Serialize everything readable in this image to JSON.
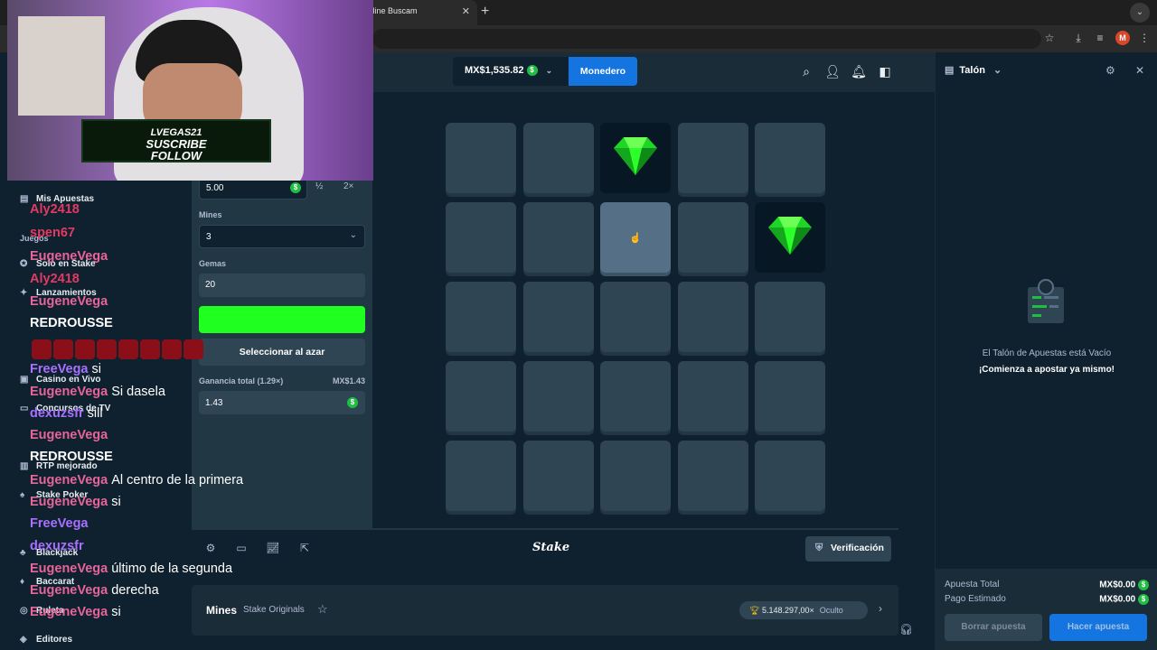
{
  "browser": {
    "tab_title": "- Jugar Online Buscam",
    "tab_close": "✕",
    "new_tab": "+",
    "profile_initial": "M"
  },
  "header": {
    "balance": "MX$1,535.82",
    "wallet_label": "Monedero"
  },
  "sidebar": {
    "items": [
      {
        "label": "Mis Apuestas",
        "icon": "list-icon"
      },
      {
        "label": "Juegos",
        "icon": ""
      },
      {
        "label": "Solo en Stake",
        "icon": "star-icon"
      },
      {
        "label": "Lanzamientos",
        "icon": "rocket-icon"
      },
      {
        "label": "Casino en Vivo",
        "icon": "cards-icon"
      },
      {
        "label": "Concursos de TV",
        "icon": "tv-icon"
      },
      {
        "label": "RTP mejorado",
        "icon": "gift-icon"
      },
      {
        "label": "Stake Poker",
        "icon": "poker-icon"
      },
      {
        "label": "Blackjack",
        "icon": "blackjack-icon"
      },
      {
        "label": "Baccarat",
        "icon": "baccarat-icon"
      },
      {
        "label": "Ruleta",
        "icon": "roulette-icon"
      },
      {
        "label": "Editores",
        "icon": "editor-icon"
      }
    ]
  },
  "controls": {
    "bet_amount": "5.00",
    "half_label": "½",
    "double_label": "2×",
    "mines_label": "Mines",
    "mines_value": "3",
    "gems_label": "Gemas",
    "gems_value": "20",
    "random_label": "Seleccionar al azar",
    "profit_label": "Ganancia total (1.29×)",
    "profit_amount": "MX$1.43",
    "profit_value": "1.43"
  },
  "board": {
    "rows": 5,
    "cols": 5,
    "revealed_gems": [
      [
        0,
        2
      ],
      [
        1,
        4
      ]
    ],
    "hovered": [
      1,
      2
    ]
  },
  "footer": {
    "logo": "Stake",
    "verify_label": "Verificación"
  },
  "game_info": {
    "title": "Mines",
    "subtitle": "Stake Originals",
    "max_win": "5.148.297,00×",
    "hidden_label": "Oculto"
  },
  "betslip": {
    "title": "Talón",
    "empty_title": "El Talón de Apuestas está Vacío",
    "empty_subtitle": "¡Comienza a apostar ya mismo!",
    "total_bet_label": "Apuesta Total",
    "total_bet_value": "MX$0.00",
    "est_payout_label": "Pago Estimado",
    "est_payout_value": "MX$0.00",
    "clear_label": "Borrar apuesta",
    "place_label": "Hacer apuesta"
  },
  "overlay": {
    "banner_line1": "LVEGAS21",
    "banner_line2": "SUSCRIBE",
    "banner_line3": "FOLLOW",
    "chat": [
      {
        "user": "Aly2418",
        "msg": "",
        "color": "#e23a62"
      },
      {
        "user": "spen67",
        "msg": "",
        "color": "#e23a62"
      },
      {
        "user": "EugeneVega",
        "msg": "",
        "color": "#e6659a"
      },
      {
        "user": "Aly2418",
        "msg": "",
        "color": "#e23a62"
      },
      {
        "user": "EugeneVega",
        "msg": "",
        "color": "#e6659a"
      },
      {
        "user": "REDROUSSE",
        "msg": "",
        "color": "#ffffff"
      },
      {
        "user": "FreeVega",
        "msg": "si",
        "color": "#a970ff"
      },
      {
        "user": "EugeneVega",
        "msg": "Si dasela",
        "color": "#e6659a"
      },
      {
        "user": "dexuzsfr",
        "msg": "sill",
        "color": "#a970ff"
      },
      {
        "user": "EugeneVega",
        "msg": "",
        "color": "#e6659a"
      },
      {
        "user": "REDROUSSE",
        "msg": "",
        "color": "#ffffff"
      },
      {
        "user": "EugeneVega",
        "msg": "Al centro de la primera",
        "color": "#e6659a"
      },
      {
        "user": "EugeneVega",
        "msg": "si",
        "color": "#e6659a"
      },
      {
        "user": "FreeVega",
        "msg": "",
        "color": "#a970ff"
      },
      {
        "user": "dexuzsfr",
        "msg": "",
        "color": "#a970ff"
      },
      {
        "user": "EugeneVega",
        "msg": "último de la segunda",
        "color": "#e6659a"
      },
      {
        "user": "EugeneVega",
        "msg": "derecha",
        "color": "#e6659a"
      },
      {
        "user": "EugeneVega",
        "msg": "si",
        "color": "#e6659a"
      }
    ]
  }
}
